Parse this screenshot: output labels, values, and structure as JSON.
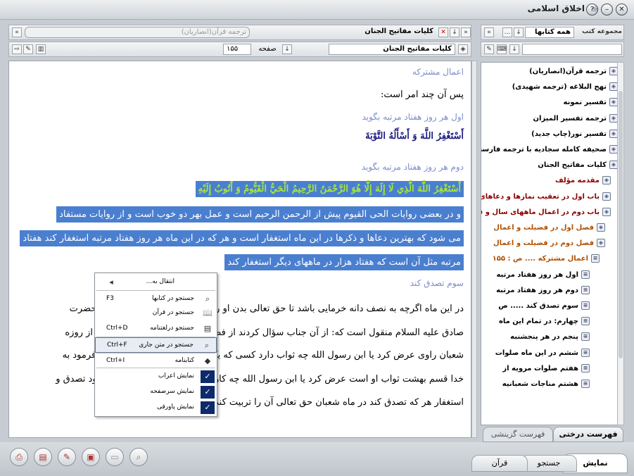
{
  "window": {
    "title": "اخلاق اسلامی"
  },
  "left_panel": {
    "tab_active": "کلیات مفاتیح الجنان",
    "tab_inactive": "ترجمه قرآن(انصاریان)",
    "book_field": "کلیات مفاتیح الجنان",
    "page_label": "صفحه",
    "page_value": "۱۵۵"
  },
  "content": {
    "lines": [
      {
        "t": "اعمال مشترکه",
        "c": "head"
      },
      {
        "t": "پس آن چند امر است:",
        "c": ""
      },
      {
        "t": "اول هر روز هفتاد مرتبه بگوید",
        "c": "head"
      },
      {
        "t": "أَسْتَغْفِرُ اللَّهَ وَ أَسْأَلُهُ التَّوْبَةَ",
        "c": "arab"
      },
      {
        "t": "دوم هر روز هفتاد مرتبه بگوید",
        "c": "head"
      },
      {
        "t": "أَسْتَغْفِرُ اللَّهَ الَّذِي لَا إِلَهَ إِلَّا هُوَ الرَّحْمَنُ الرَّحِيمُ الْحَيُّ الْقَيُّومُ وَ أَتُوبُ إِلَيْهِ",
        "c": "hlg"
      },
      {
        "t": "و در بعضی روایات الحی القیوم پیش از الرحمن الرحیم است و عمل بهر دو خوب است و از روایات مستفاد",
        "c": "hl"
      },
      {
        "t": "می شود که بهترین دعاها و ذکرها در این ماه استغفار است و هر که در این ماه هر روز هفتاد مرتبه استغفار کند هفتاد",
        "c": "hl"
      },
      {
        "t": "مرتبه مثل آن است که هفتاد هزار در ماههای دیگر استغفار کند",
        "c": "hl"
      },
      {
        "t": "سوم تصدق کند",
        "c": "head"
      },
      {
        "t": "در این ماه اگرچه به نصف دانه خرمایی باشد تا حق تعالی بدن او را بر آتش جهنم حرام گرداند (از حضرت",
        "c": ""
      },
      {
        "t": "صادق علیه السلام منقول است که: از آن جناب سؤال کردند از فضیلت روزه ماه رجب، چرا غافلید از روزه",
        "c": ""
      },
      {
        "t": "شعبان راوی عرض کرد یا ابن رسول الله چه ثواب دارد کسی که یک روز از ماه شعبان روزه بدارد فرمود به",
        "c": ""
      },
      {
        "t": "خدا قسم بهشت ثواب او است عرض کرد یا ابن رسول الله چه کار کنیم در این ماه بهتر است فرمود تصدق و",
        "c": ""
      },
      {
        "t": "استغفار هر که تصدق کند در ماه شعبان حق تعالی آن را تربیت کند چنانکه شما شتر بچه اش را",
        "c": ""
      }
    ]
  },
  "context_menu": {
    "items": [
      {
        "label": "انتقال به...",
        "shortcut": "",
        "icon": "arrow-icon",
        "type": "sub"
      },
      {
        "label": "جستجو در کتابها",
        "shortcut": "F3",
        "icon": "search-icon",
        "type": "item"
      },
      {
        "label": "جستجو در قرآن",
        "shortcut": "",
        "icon": "book-icon",
        "type": "item"
      },
      {
        "label": "جستجو درلغتنامه",
        "shortcut": "Ctrl+D",
        "icon": "dictionary-icon",
        "type": "item"
      },
      {
        "label": "جستجو در متن جاری",
        "shortcut": "Ctrl+F",
        "icon": "search-icon",
        "type": "selected"
      },
      {
        "label": "کتابنامه",
        "shortcut": "Ctrl+I",
        "icon": "bookmark-icon",
        "type": "item"
      },
      {
        "label": "نمایش اعراب",
        "shortcut": "",
        "icon": "check-icon",
        "type": "check"
      },
      {
        "label": "نمایش سرصفحه",
        "shortcut": "",
        "icon": "check-icon",
        "type": "check"
      },
      {
        "label": "نمایش پاورقی",
        "shortcut": "",
        "icon": "check-icon",
        "type": "check"
      }
    ]
  },
  "right_panel": {
    "collection_label": "مجموعه کتب",
    "collection_value": "همه کتابها",
    "tree": [
      {
        "label": "ترجمه قرآن(انصاریان)",
        "level": 0,
        "color": "#000"
      },
      {
        "label": "نهج البلاغه (ترجمه شهیدی)",
        "level": 0,
        "color": "#000"
      },
      {
        "label": "تفسیر نمونه",
        "level": 0,
        "color": "#000"
      },
      {
        "label": "ترجمه تفسیر المیزان",
        "level": 0,
        "color": "#000"
      },
      {
        "label": "تفسیر نور(چاپ جدید)",
        "level": 0,
        "color": "#000"
      },
      {
        "label": "صحیفه کامله سجادیه با ترجمه فارسی",
        "level": 0,
        "color": "#000"
      },
      {
        "label": "کلیات مفاتیح الجنان",
        "level": 0,
        "color": "#000"
      },
      {
        "label": "مقدمه مؤلف",
        "level": 1,
        "color": "#8b0000"
      },
      {
        "label": "باب اول در تعقیب نمازها و دعاهای",
        "level": 1,
        "color": "#8b0000"
      },
      {
        "label": "باب دوم در اعمال ماههای سال و فضیلت",
        "level": 1,
        "color": "#8b0000"
      },
      {
        "label": "فصل اول در فضیلت و اعمال",
        "level": 2,
        "color": "#b05000"
      },
      {
        "label": "فصل دوم در فضیلت و اعمال",
        "level": 2,
        "color": "#b05000"
      },
      {
        "label": "اعمال مشترکه .... ص : ۱۵۵",
        "level": 3,
        "color": "#b05000"
      },
      {
        "label": "اول هر روز هفتاد مرتبه",
        "level": 4,
        "color": "#000"
      },
      {
        "label": "دوم هر روز هفتاد مرتبه",
        "level": 4,
        "color": "#000"
      },
      {
        "label": "سوم تصدق کند ..... ص",
        "level": 4,
        "color": "#000"
      },
      {
        "label": "چهارم: در تمام این ماه",
        "level": 4,
        "color": "#000"
      },
      {
        "label": "پنجم در هر پنجشنبه",
        "level": 4,
        "color": "#000"
      },
      {
        "label": "ششم در این ماه صلوات",
        "level": 4,
        "color": "#000"
      },
      {
        "label": "هفتم صلوات مرویه از",
        "level": 4,
        "color": "#000"
      },
      {
        "label": "هشتم مناجات شعبانیه",
        "level": 4,
        "color": "#000"
      }
    ],
    "tab_tree": "فهرست درختی",
    "tab_flat": "فهرست گزینشی"
  },
  "bottom_tabs": [
    "نمایش",
    "جستجو",
    "قرآن"
  ]
}
